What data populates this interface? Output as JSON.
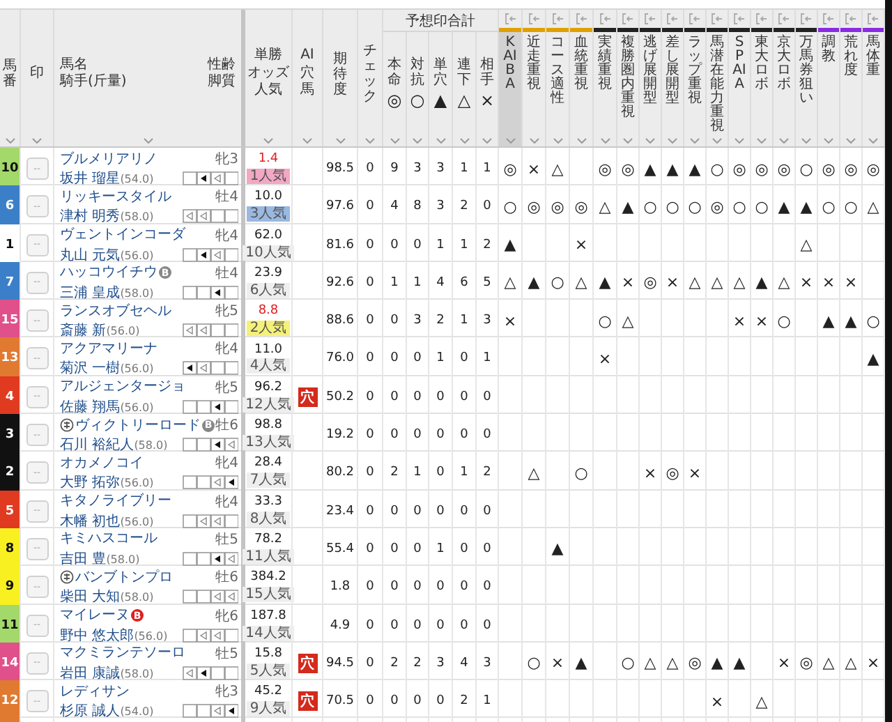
{
  "header": {
    "gate": "馬番",
    "mark": "印",
    "name": "馬名",
    "jockey": "騎手(斤量)",
    "sex_age": "性齢",
    "style": "脚質",
    "odds": [
      "単勝",
      "オッズ",
      "人気"
    ],
    "ai": [
      "AI",
      "穴",
      "馬"
    ],
    "expect": "期待度",
    "check": "チェック",
    "tally_group": "予想印合計",
    "tally": [
      {
        "label": "本命",
        "symbol": "◎"
      },
      {
        "label": "対抗",
        "symbol": "○"
      },
      {
        "label": "単穴",
        "symbol": "▲"
      },
      {
        "label": "連下",
        "symbol": "△"
      },
      {
        "label": "相手",
        "symbol": "×"
      }
    ],
    "factors": [
      {
        "label": "KAIBA",
        "color": "#e0a000",
        "selected": true
      },
      {
        "label": "近走重視",
        "color": "#e0a000",
        "selected": false
      },
      {
        "label": "コース適性",
        "color": "#e0a000",
        "selected": false
      },
      {
        "label": "血統重視",
        "color": "#e0a000",
        "selected": false
      },
      {
        "label": "実績重視",
        "color": "#222222",
        "selected": false
      },
      {
        "label": "複勝圏内重視",
        "color": "#222222",
        "selected": false
      },
      {
        "label": "逃げ展開型",
        "color": "#222222",
        "selected": false
      },
      {
        "label": "差し展開型",
        "color": "#222222",
        "selected": false
      },
      {
        "label": "ラップ重視",
        "color": "#222222",
        "selected": false
      },
      {
        "label": "馬潜在能力重視",
        "color": "#222222",
        "selected": false
      },
      {
        "label": "SPAIA",
        "color": "#222222",
        "selected": false
      },
      {
        "label": "東大ロボ",
        "color": "#222222",
        "selected": false
      },
      {
        "label": "京大ロボ",
        "color": "#222222",
        "selected": false
      },
      {
        "label": "万馬券狙い",
        "color": "#222222",
        "selected": false
      },
      {
        "label": "調教",
        "color": "#8a2be2",
        "selected": false
      },
      {
        "label": "荒れ度",
        "color": "#8a2be2",
        "selected": false
      },
      {
        "label": "馬体重",
        "color": "#8a2be2",
        "selected": false
      }
    ]
  },
  "rows": [
    {
      "gate": "10",
      "color": "#a3d86a",
      "mark": "--",
      "name": "ブルメリアリノ",
      "circle_mark": false,
      "sex": "牝3",
      "jockey": "坂井 瑠星",
      "weight": "(54.0)",
      "style": [
        {
          "kind": "blank"
        },
        {
          "kind": "filled"
        },
        {
          "kind": "hollow"
        },
        {
          "kind": "blank"
        }
      ],
      "odds": "1.4",
      "odds_hot": true,
      "popularity": {
        "text": "1人気",
        "color": "#f2a7c3"
      },
      "expect": "98.5",
      "check": "0",
      "tally": [
        "9",
        "3",
        "3",
        "1",
        "1"
      ],
      "marks": [
        {
          "kind": "mark",
          "symbol": "◎"
        },
        {
          "kind": "mark",
          "symbol": "×"
        },
        {
          "kind": "mark",
          "symbol": "△"
        },
        {
          "kind": "blank"
        },
        {
          "kind": "mark",
          "symbol": "◎"
        },
        {
          "kind": "mark",
          "symbol": "◎"
        },
        {
          "kind": "mark",
          "symbol": "▲"
        },
        {
          "kind": "mark",
          "symbol": "▲"
        },
        {
          "kind": "mark",
          "symbol": "▲"
        },
        {
          "kind": "mark",
          "symbol": "○"
        },
        {
          "kind": "mark",
          "symbol": "◎"
        },
        {
          "kind": "mark",
          "symbol": "◎"
        },
        {
          "kind": "mark",
          "symbol": "◎"
        },
        {
          "kind": "mark",
          "symbol": "○"
        },
        {
          "kind": "mark",
          "symbol": "◎"
        },
        {
          "kind": "mark",
          "symbol": "◎"
        },
        {
          "kind": "mark",
          "symbol": "◎"
        }
      ]
    },
    {
      "gate": "6",
      "color": "#3b7fc8",
      "mark": "--",
      "name": "リッキースタイル",
      "circle_mark": false,
      "sex": "牡4",
      "jockey": "津村 明秀",
      "weight": "(58.0)",
      "style": [
        {
          "kind": "hollow"
        },
        {
          "kind": "hollow"
        },
        {
          "kind": "blank"
        },
        {
          "kind": "blank"
        }
      ],
      "odds": "10.0",
      "odds_hot": false,
      "popularity": {
        "text": "3人気",
        "color": "#9ab8e0"
      },
      "expect": "97.6",
      "check": "0",
      "tally": [
        "4",
        "8",
        "3",
        "2",
        "0"
      ],
      "marks": [
        {
          "kind": "mark",
          "symbol": "○"
        },
        {
          "kind": "mark",
          "symbol": "◎"
        },
        {
          "kind": "mark",
          "symbol": "◎"
        },
        {
          "kind": "mark",
          "symbol": "◎"
        },
        {
          "kind": "mark",
          "symbol": "△"
        },
        {
          "kind": "mark",
          "symbol": "▲"
        },
        {
          "kind": "mark",
          "symbol": "○"
        },
        {
          "kind": "mark",
          "symbol": "○"
        },
        {
          "kind": "mark",
          "symbol": "○"
        },
        {
          "kind": "mark",
          "symbol": "◎"
        },
        {
          "kind": "mark",
          "symbol": "○"
        },
        {
          "kind": "mark",
          "symbol": "○"
        },
        {
          "kind": "mark",
          "symbol": "▲"
        },
        {
          "kind": "mark",
          "symbol": "▲"
        },
        {
          "kind": "mark",
          "symbol": "○"
        },
        {
          "kind": "mark",
          "symbol": "○"
        },
        {
          "kind": "mark",
          "symbol": "△"
        }
      ]
    },
    {
      "gate": "1",
      "color": "#ffffff",
      "mark": "--",
      "name": "ヴェントインコーダ",
      "circle_mark": false,
      "sex": "牝4",
      "jockey": "丸山 元気",
      "weight": "(56.0)",
      "style": [
        {
          "kind": "blank"
        },
        {
          "kind": "filled"
        },
        {
          "kind": "hollow"
        },
        {
          "kind": "blank"
        }
      ],
      "odds": "62.0",
      "odds_hot": false,
      "popularity": {
        "text": "10人気",
        "color": "#eeeeee"
      },
      "expect": "81.6",
      "check": "0",
      "tally": [
        "0",
        "0",
        "1",
        "1",
        "2"
      ],
      "marks": [
        {
          "kind": "mark",
          "symbol": "▲"
        },
        {
          "kind": "blank"
        },
        {
          "kind": "blank"
        },
        {
          "kind": "mark",
          "symbol": "×"
        },
        {
          "kind": "blank"
        },
        {
          "kind": "blank"
        },
        {
          "kind": "blank"
        },
        {
          "kind": "blank"
        },
        {
          "kind": "blank"
        },
        {
          "kind": "blank"
        },
        {
          "kind": "blank"
        },
        {
          "kind": "blank"
        },
        {
          "kind": "blank"
        },
        {
          "kind": "mark",
          "symbol": "△"
        },
        {
          "kind": "blank"
        },
        {
          "kind": "blank"
        },
        {
          "kind": "blank"
        }
      ]
    },
    {
      "gate": "7",
      "color": "#3b7fc8",
      "mark": "--",
      "name": "ハッコウイチウ",
      "circle_mark": false,
      "blinker": {
        "label": "B",
        "first": false
      },
      "sex": "牡4",
      "jockey": "三浦 皇成",
      "weight": "(58.0)",
      "style": [
        {
          "kind": "blank"
        },
        {
          "kind": "blank"
        },
        {
          "kind": "filled"
        },
        {
          "kind": "blank"
        }
      ],
      "odds": "23.9",
      "odds_hot": false,
      "popularity": {
        "text": "6人気",
        "color": "#eeeeee"
      },
      "expect": "92.6",
      "check": "0",
      "tally": [
        "1",
        "1",
        "4",
        "6",
        "5"
      ],
      "marks": [
        {
          "kind": "mark",
          "symbol": "△"
        },
        {
          "kind": "mark",
          "symbol": "▲"
        },
        {
          "kind": "mark",
          "symbol": "○"
        },
        {
          "kind": "mark",
          "symbol": "△"
        },
        {
          "kind": "mark",
          "symbol": "▲"
        },
        {
          "kind": "mark",
          "symbol": "×"
        },
        {
          "kind": "mark",
          "symbol": "◎"
        },
        {
          "kind": "mark",
          "symbol": "×"
        },
        {
          "kind": "mark",
          "symbol": "△"
        },
        {
          "kind": "mark",
          "symbol": "△"
        },
        {
          "kind": "mark",
          "symbol": "△"
        },
        {
          "kind": "mark",
          "symbol": "▲"
        },
        {
          "kind": "mark",
          "symbol": "△"
        },
        {
          "kind": "mark",
          "symbol": "×"
        },
        {
          "kind": "mark",
          "symbol": "×"
        },
        {
          "kind": "mark",
          "symbol": "×"
        },
        {
          "kind": "blank"
        }
      ]
    },
    {
      "gate": "15",
      "color": "#e0508a",
      "mark": "--",
      "name": "ランスオブセヘル",
      "circle_mark": false,
      "sex": "牝5",
      "jockey": "斎藤 新",
      "weight": "(56.0)",
      "style": [
        {
          "kind": "hollow"
        },
        {
          "kind": "hollow"
        },
        {
          "kind": "blank"
        },
        {
          "kind": "blank"
        }
      ],
      "odds": "8.8",
      "odds_hot": true,
      "popularity": {
        "text": "2人気",
        "color": "#f5f07a"
      },
      "expect": "88.6",
      "check": "0",
      "tally": [
        "0",
        "3",
        "2",
        "1",
        "3"
      ],
      "marks": [
        {
          "kind": "mark",
          "symbol": "×"
        },
        {
          "kind": "blank"
        },
        {
          "kind": "blank"
        },
        {
          "kind": "blank"
        },
        {
          "kind": "mark",
          "symbol": "○"
        },
        {
          "kind": "mark",
          "symbol": "△"
        },
        {
          "kind": "blank"
        },
        {
          "kind": "blank"
        },
        {
          "kind": "blank"
        },
        {
          "kind": "blank"
        },
        {
          "kind": "mark",
          "symbol": "×"
        },
        {
          "kind": "mark",
          "symbol": "×"
        },
        {
          "kind": "mark",
          "symbol": "○"
        },
        {
          "kind": "blank"
        },
        {
          "kind": "mark",
          "symbol": "▲"
        },
        {
          "kind": "mark",
          "symbol": "▲"
        },
        {
          "kind": "mark",
          "symbol": "○"
        }
      ]
    },
    {
      "gate": "13",
      "color": "#e07a30",
      "mark": "--",
      "name": "アクアマリーナ",
      "circle_mark": false,
      "sex": "牝4",
      "jockey": "菊沢 一樹",
      "weight": "(56.0)",
      "style": [
        {
          "kind": "filled"
        },
        {
          "kind": "hollow"
        },
        {
          "kind": "blank"
        },
        {
          "kind": "blank"
        }
      ],
      "odds": "11.0",
      "odds_hot": false,
      "popularity": {
        "text": "4人気",
        "color": "#eeeeee"
      },
      "expect": "76.0",
      "check": "0",
      "tally": [
        "0",
        "0",
        "1",
        "0",
        "1"
      ],
      "marks": [
        {
          "kind": "blank"
        },
        {
          "kind": "blank"
        },
        {
          "kind": "blank"
        },
        {
          "kind": "blank"
        },
        {
          "kind": "mark",
          "symbol": "×"
        },
        {
          "kind": "blank"
        },
        {
          "kind": "blank"
        },
        {
          "kind": "blank"
        },
        {
          "kind": "blank"
        },
        {
          "kind": "blank"
        },
        {
          "kind": "blank"
        },
        {
          "kind": "blank"
        },
        {
          "kind": "blank"
        },
        {
          "kind": "blank"
        },
        {
          "kind": "blank"
        },
        {
          "kind": "blank"
        },
        {
          "kind": "mark",
          "symbol": "▲"
        }
      ]
    },
    {
      "gate": "4",
      "color": "#e03a20",
      "mark": "--",
      "name": "アルジェンタージョ",
      "circle_mark": false,
      "sex": "牝5",
      "jockey": "佐藤 翔馬",
      "weight": "(56.0)",
      "style": [
        {
          "kind": "blank"
        },
        {
          "kind": "blank"
        },
        {
          "kind": "filled"
        },
        {
          "kind": "blank"
        }
      ],
      "odds": "96.2",
      "odds_hot": false,
      "popularity": {
        "text": "12人気",
        "color": "#eeeeee"
      },
      "ai": "穴",
      "expect": "50.2",
      "check": "0",
      "tally": [
        "0",
        "0",
        "0",
        "0",
        "0"
      ],
      "marks": [
        {
          "kind": "blank"
        },
        {
          "kind": "blank"
        },
        {
          "kind": "blank"
        },
        {
          "kind": "blank"
        },
        {
          "kind": "blank"
        },
        {
          "kind": "blank"
        },
        {
          "kind": "blank"
        },
        {
          "kind": "blank"
        },
        {
          "kind": "blank"
        },
        {
          "kind": "blank"
        },
        {
          "kind": "blank"
        },
        {
          "kind": "blank"
        },
        {
          "kind": "blank"
        },
        {
          "kind": "blank"
        },
        {
          "kind": "blank"
        },
        {
          "kind": "blank"
        },
        {
          "kind": "blank"
        }
      ]
    },
    {
      "gate": "3",
      "color": "#111111",
      "mark": "--",
      "name": "ヴィクトリーロード",
      "circle_mark": true,
      "blinker": {
        "label": "B",
        "first": false
      },
      "sex": "牡6",
      "jockey": "石川 裕紀人",
      "weight": "(58.0)",
      "style": [
        {
          "kind": "blank"
        },
        {
          "kind": "blank"
        },
        {
          "kind": "filled"
        },
        {
          "kind": "hollow"
        }
      ],
      "odds": "98.8",
      "odds_hot": false,
      "popularity": {
        "text": "13人気",
        "color": "#eeeeee"
      },
      "expect": "19.2",
      "check": "0",
      "tally": [
        "0",
        "0",
        "0",
        "0",
        "0"
      ],
      "marks": [
        {
          "kind": "blank"
        },
        {
          "kind": "blank"
        },
        {
          "kind": "blank"
        },
        {
          "kind": "blank"
        },
        {
          "kind": "blank"
        },
        {
          "kind": "blank"
        },
        {
          "kind": "blank"
        },
        {
          "kind": "blank"
        },
        {
          "kind": "blank"
        },
        {
          "kind": "blank"
        },
        {
          "kind": "blank"
        },
        {
          "kind": "blank"
        },
        {
          "kind": "blank"
        },
        {
          "kind": "blank"
        },
        {
          "kind": "blank"
        },
        {
          "kind": "blank"
        },
        {
          "kind": "blank"
        }
      ]
    },
    {
      "gate": "2",
      "color": "#111111",
      "mark": "--",
      "name": "オカメノコイ",
      "circle_mark": false,
      "sex": "牝4",
      "jockey": "大野 拓弥",
      "weight": "(56.0)",
      "style": [
        {
          "kind": "blank"
        },
        {
          "kind": "blank"
        },
        {
          "kind": "hollow"
        },
        {
          "kind": "filled"
        }
      ],
      "odds": "28.4",
      "odds_hot": false,
      "popularity": {
        "text": "7人気",
        "color": "#eeeeee"
      },
      "expect": "80.2",
      "check": "0",
      "tally": [
        "2",
        "1",
        "0",
        "1",
        "2"
      ],
      "marks": [
        {
          "kind": "blank"
        },
        {
          "kind": "mark",
          "symbol": "△"
        },
        {
          "kind": "blank"
        },
        {
          "kind": "mark",
          "symbol": "○"
        },
        {
          "kind": "blank"
        },
        {
          "kind": "blank"
        },
        {
          "kind": "mark",
          "symbol": "×"
        },
        {
          "kind": "mark",
          "symbol": "◎"
        },
        {
          "kind": "mark",
          "symbol": "×"
        },
        {
          "kind": "blank"
        },
        {
          "kind": "blank"
        },
        {
          "kind": "blank"
        },
        {
          "kind": "blank"
        },
        {
          "kind": "blank"
        },
        {
          "kind": "blank"
        },
        {
          "kind": "blank"
        },
        {
          "kind": "blank"
        }
      ]
    },
    {
      "gate": "5",
      "color": "#e03a20",
      "mark": "--",
      "name": "キタノライブリー",
      "circle_mark": false,
      "sex": "牝4",
      "jockey": "木幡 初也",
      "weight": "(56.0)",
      "style": [
        {
          "kind": "blank"
        },
        {
          "kind": "hollow"
        },
        {
          "kind": "hollow"
        },
        {
          "kind": "blank"
        }
      ],
      "odds": "33.3",
      "odds_hot": false,
      "popularity": {
        "text": "8人気",
        "color": "#eeeeee"
      },
      "expect": "23.4",
      "check": "0",
      "tally": [
        "0",
        "0",
        "0",
        "0",
        "0"
      ],
      "marks": [
        {
          "kind": "blank"
        },
        {
          "kind": "blank"
        },
        {
          "kind": "blank"
        },
        {
          "kind": "blank"
        },
        {
          "kind": "blank"
        },
        {
          "kind": "blank"
        },
        {
          "kind": "blank"
        },
        {
          "kind": "blank"
        },
        {
          "kind": "blank"
        },
        {
          "kind": "blank"
        },
        {
          "kind": "blank"
        },
        {
          "kind": "blank"
        },
        {
          "kind": "blank"
        },
        {
          "kind": "blank"
        },
        {
          "kind": "blank"
        },
        {
          "kind": "blank"
        },
        {
          "kind": "blank"
        }
      ]
    },
    {
      "gate": "8",
      "color": "#f8f020",
      "mark": "--",
      "name": "キミハスコール",
      "circle_mark": false,
      "sex": "牡5",
      "jockey": "吉田 豊",
      "weight": "(58.0)",
      "style": [
        {
          "kind": "blank"
        },
        {
          "kind": "blank"
        },
        {
          "kind": "filled"
        },
        {
          "kind": "hollow"
        }
      ],
      "odds": "78.2",
      "odds_hot": false,
      "popularity": {
        "text": "11人気",
        "color": "#eeeeee"
      },
      "expect": "55.4",
      "check": "0",
      "tally": [
        "0",
        "0",
        "1",
        "0",
        "0"
      ],
      "marks": [
        {
          "kind": "blank"
        },
        {
          "kind": "blank"
        },
        {
          "kind": "mark",
          "symbol": "▲"
        },
        {
          "kind": "blank"
        },
        {
          "kind": "blank"
        },
        {
          "kind": "blank"
        },
        {
          "kind": "blank"
        },
        {
          "kind": "blank"
        },
        {
          "kind": "blank"
        },
        {
          "kind": "blank"
        },
        {
          "kind": "blank"
        },
        {
          "kind": "blank"
        },
        {
          "kind": "blank"
        },
        {
          "kind": "blank"
        },
        {
          "kind": "blank"
        },
        {
          "kind": "blank"
        },
        {
          "kind": "blank"
        }
      ]
    },
    {
      "gate": "9",
      "color": "#f8f020",
      "mark": "--",
      "name": "バンブトンプロ",
      "circle_mark": true,
      "sex": "牡6",
      "jockey": "柴田 大知",
      "weight": "(58.0)",
      "style": [
        {
          "kind": "blank"
        },
        {
          "kind": "blank"
        },
        {
          "kind": "hollow"
        },
        {
          "kind": "hollow"
        }
      ],
      "odds": "384.2",
      "odds_hot": false,
      "popularity": {
        "text": "15人気",
        "color": "#eeeeee"
      },
      "expect": "1.8",
      "check": "0",
      "tally": [
        "0",
        "0",
        "0",
        "0",
        "0"
      ],
      "marks": [
        {
          "kind": "blank"
        },
        {
          "kind": "blank"
        },
        {
          "kind": "blank"
        },
        {
          "kind": "blank"
        },
        {
          "kind": "blank"
        },
        {
          "kind": "blank"
        },
        {
          "kind": "blank"
        },
        {
          "kind": "blank"
        },
        {
          "kind": "blank"
        },
        {
          "kind": "blank"
        },
        {
          "kind": "blank"
        },
        {
          "kind": "blank"
        },
        {
          "kind": "blank"
        },
        {
          "kind": "blank"
        },
        {
          "kind": "blank"
        },
        {
          "kind": "blank"
        },
        {
          "kind": "blank"
        }
      ]
    },
    {
      "gate": "11",
      "color": "#a3d86a",
      "mark": "--",
      "name": "マイレーヌ",
      "circle_mark": false,
      "blinker": {
        "label": "B",
        "first": true
      },
      "sex": "牝6",
      "jockey": "野中 悠太郎",
      "weight": "(56.0)",
      "style": [
        {
          "kind": "blank"
        },
        {
          "kind": "hollow"
        },
        {
          "kind": "hollow"
        },
        {
          "kind": "blank"
        }
      ],
      "odds": "187.8",
      "odds_hot": false,
      "popularity": {
        "text": "14人気",
        "color": "#eeeeee"
      },
      "expect": "4.9",
      "check": "0",
      "tally": [
        "0",
        "0",
        "0",
        "0",
        "0"
      ],
      "marks": [
        {
          "kind": "blank"
        },
        {
          "kind": "blank"
        },
        {
          "kind": "blank"
        },
        {
          "kind": "blank"
        },
        {
          "kind": "blank"
        },
        {
          "kind": "blank"
        },
        {
          "kind": "blank"
        },
        {
          "kind": "blank"
        },
        {
          "kind": "blank"
        },
        {
          "kind": "blank"
        },
        {
          "kind": "blank"
        },
        {
          "kind": "blank"
        },
        {
          "kind": "blank"
        },
        {
          "kind": "blank"
        },
        {
          "kind": "blank"
        },
        {
          "kind": "blank"
        },
        {
          "kind": "blank"
        }
      ]
    },
    {
      "gate": "14",
      "color": "#e0508a",
      "mark": "--",
      "name": "マクミランテソーロ",
      "circle_mark": false,
      "sex": "牡5",
      "jockey": "岩田 康誠",
      "weight": "(58.0)",
      "style": [
        {
          "kind": "hollow"
        },
        {
          "kind": "filled"
        },
        {
          "kind": "blank"
        },
        {
          "kind": "blank"
        }
      ],
      "odds": "15.8",
      "odds_hot": false,
      "popularity": {
        "text": "5人気",
        "color": "#eeeeee"
      },
      "ai": "穴",
      "expect": "94.5",
      "check": "0",
      "tally": [
        "2",
        "2",
        "3",
        "4",
        "3"
      ],
      "marks": [
        {
          "kind": "blank"
        },
        {
          "kind": "mark",
          "symbol": "○"
        },
        {
          "kind": "mark",
          "symbol": "×"
        },
        {
          "kind": "mark",
          "symbol": "▲"
        },
        {
          "kind": "blank"
        },
        {
          "kind": "mark",
          "symbol": "○"
        },
        {
          "kind": "mark",
          "symbol": "△"
        },
        {
          "kind": "mark",
          "symbol": "△"
        },
        {
          "kind": "mark",
          "symbol": "◎"
        },
        {
          "kind": "mark",
          "symbol": "▲"
        },
        {
          "kind": "mark",
          "symbol": "▲"
        },
        {
          "kind": "blank"
        },
        {
          "kind": "mark",
          "symbol": "×"
        },
        {
          "kind": "mark",
          "symbol": "◎"
        },
        {
          "kind": "mark",
          "symbol": "△"
        },
        {
          "kind": "mark",
          "symbol": "△"
        },
        {
          "kind": "mark",
          "symbol": "×"
        }
      ]
    },
    {
      "gate": "12",
      "color": "#e07a30",
      "mark": "--",
      "name": "レディサン",
      "circle_mark": false,
      "sex": "牝3",
      "jockey": "杉原 誠人",
      "weight": "(54.0)",
      "style": [
        {
          "kind": "blank"
        },
        {
          "kind": "blank"
        },
        {
          "kind": "hollow"
        },
        {
          "kind": "filled"
        }
      ],
      "odds": "45.2",
      "odds_hot": false,
      "popularity": {
        "text": "9人気",
        "color": "#eeeeee"
      },
      "ai": "穴",
      "expect": "70.5",
      "check": "0",
      "tally": [
        "0",
        "0",
        "0",
        "2",
        "1"
      ],
      "marks": [
        {
          "kind": "blank"
        },
        {
          "kind": "blank"
        },
        {
          "kind": "blank"
        },
        {
          "kind": "blank"
        },
        {
          "kind": "blank"
        },
        {
          "kind": "blank"
        },
        {
          "kind": "blank"
        },
        {
          "kind": "blank"
        },
        {
          "kind": "blank"
        },
        {
          "kind": "mark",
          "symbol": "×"
        },
        {
          "kind": "blank"
        },
        {
          "kind": "mark",
          "symbol": "△"
        },
        {
          "kind": "blank"
        },
        {
          "kind": "blank"
        },
        {
          "kind": "blank"
        },
        {
          "kind": "blank"
        },
        {
          "kind": "blank"
        }
      ]
    }
  ]
}
